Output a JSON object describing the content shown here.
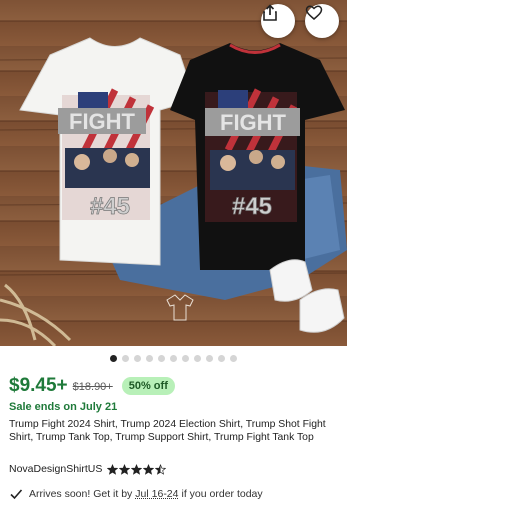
{
  "listing": {
    "price": "$9.45+",
    "original_price": "$18.90+",
    "discount": "50% off",
    "sale_ends": "Sale ends on July 21",
    "title": "Trump Fight 2024 Shirt, Trump 2024 Election Shirt, Trump Shot Fight Shirt, Trump Tank Top, Trump Support Shirt, Trump Fight Tank Top",
    "shop_name": "NovaDesignShirtUS",
    "rating_stars": 4.5
  },
  "image": {
    "shirt_text_top": "FIGHT",
    "shirt_text_bottom": "#45",
    "carousel_count": 11,
    "carousel_active": 0
  },
  "delivery": {
    "prefix": "Arrives soon! Get it by",
    "dates": "Jul 16-24",
    "suffix": "if you order today"
  },
  "icons": {
    "share": "share-icon",
    "favorite": "heart-icon",
    "check": "check-icon",
    "star": "star-icon"
  },
  "colors": {
    "price_green": "#1f7a3a",
    "badge_bg": "#b8f0b8"
  }
}
